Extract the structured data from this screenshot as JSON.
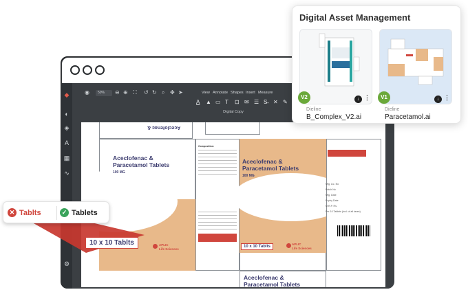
{
  "dam": {
    "title": "Digital Asset Management",
    "assets": [
      {
        "version": "V2",
        "caption": "Dieline",
        "filename": "B_Complex_V2.ai"
      },
      {
        "version": "V1",
        "caption": "Dieline",
        "filename": "Paracetamol.ai"
      }
    ]
  },
  "editor": {
    "zoom": "50%",
    "menu": [
      "View",
      "Annotate",
      "Shapes",
      "Insert",
      "Measure"
    ],
    "document_label": "Digital Copy"
  },
  "package": {
    "title_line1": "Aceclofenac &",
    "title_line2": "Paracetamol Tablets",
    "dose": "100 MG",
    "quantity": "10 x 10 Tablts",
    "brand_line1": "APLIC",
    "brand_line2": "Life Sciences",
    "rotated_title": "Aceclofenac &",
    "composition_label": "Composition:",
    "mfg_labels": [
      "Mfg. Lic. No",
      "Batch No",
      "Mfg. Date",
      "Expiry Date",
      "M.R.P. Rs.",
      "Per 10 Tablets (incl. of all taxes)"
    ]
  },
  "proofing": {
    "wrong_label": "Tablts",
    "right_label": "Tablets",
    "wrong_color": "#d0463d",
    "right_color": "#3aa35b"
  },
  "colors": {
    "accent_orange": "#e8b98a",
    "brand_navy": "#3b3b6e",
    "version_green": "#6aa83a"
  }
}
